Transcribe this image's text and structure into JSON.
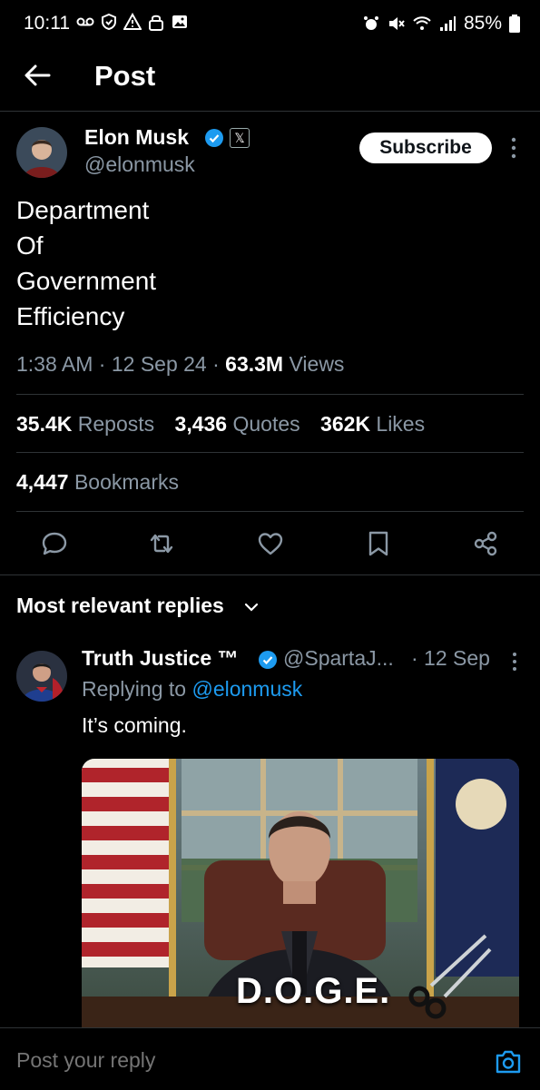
{
  "status_bar": {
    "time": "10:11",
    "battery": "85%"
  },
  "header": {
    "title": "Post"
  },
  "post": {
    "author_name": "Elon Musk",
    "author_handle": "@elonmusk",
    "subscribe_label": "Subscribe",
    "text": "Department\nOf\nGovernment\nEfficiency",
    "time": "1:38 AM",
    "date": "12 Sep 24",
    "views_count": "63.3M",
    "views_label": "Views",
    "reposts_count": "35.4K",
    "reposts_label": "Reposts",
    "quotes_count": "3,436",
    "quotes_label": "Quotes",
    "likes_count": "362K",
    "likes_label": "Likes",
    "bookmarks_count": "4,447",
    "bookmarks_label": "Bookmarks"
  },
  "replies_section": {
    "sort_label": "Most relevant replies"
  },
  "reply": {
    "author_name": "Truth Justice ™",
    "author_handle": "@SpartaJ...",
    "date": "· 12 Sep",
    "replying_prefix": "Replying to",
    "replying_to": "@elonmusk",
    "text": "It’s coming.",
    "image_caption": "D.O.G.E."
  },
  "composer": {
    "placeholder": "Post your reply"
  },
  "colors": {
    "background": "#000000",
    "accent": "#1d9bf0",
    "muted": "#8b98a5",
    "divider": "#2f3336"
  }
}
